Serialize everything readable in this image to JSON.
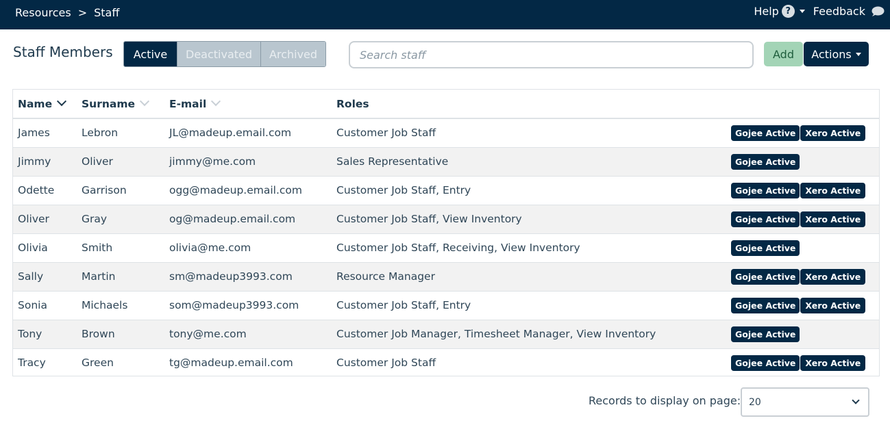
{
  "breadcrumb": {
    "root": "Resources",
    "separator": ">",
    "current": "Staff"
  },
  "topbar": {
    "help_label": "Help",
    "help_icon": "?",
    "feedback_label": "Feedback"
  },
  "page": {
    "title": "Staff Members"
  },
  "tabs": [
    {
      "label": "Active",
      "selected": true
    },
    {
      "label": "Deactivated",
      "selected": false
    },
    {
      "label": "Archived",
      "selected": false
    }
  ],
  "search": {
    "placeholder": "Search staff",
    "value": ""
  },
  "buttons": {
    "add": "Add",
    "actions": "Actions"
  },
  "table": {
    "columns": [
      {
        "label": "Name",
        "sorted": true
      },
      {
        "label": "Surname",
        "sorted": false
      },
      {
        "label": "E-mail",
        "sorted": false
      },
      {
        "label": "Roles"
      }
    ],
    "rows": [
      {
        "name": "James",
        "surname": "Lebron",
        "email": "JL@madeup.email.com",
        "roles": "Customer Job Staff",
        "gojee": "Gojee Active",
        "xero": "Xero Active"
      },
      {
        "name": "Jimmy",
        "surname": "Oliver",
        "email": "jimmy@me.com",
        "roles": "Sales Representative",
        "gojee": "Gojee Active",
        "xero": ""
      },
      {
        "name": "Odette",
        "surname": "Garrison",
        "email": "ogg@madeup.email.com",
        "roles": "Customer Job Staff, Entry",
        "gojee": "Gojee Active",
        "xero": "Xero Active"
      },
      {
        "name": "Oliver",
        "surname": "Gray",
        "email": "og@madeup.email.com",
        "roles": "Customer Job Staff, View Inventory",
        "gojee": "Gojee Active",
        "xero": "Xero Active"
      },
      {
        "name": "Olivia",
        "surname": "Smith",
        "email": "olivia@me.com",
        "roles": "Customer Job Staff, Receiving, View Inventory",
        "gojee": "Gojee Active",
        "xero": ""
      },
      {
        "name": "Sally",
        "surname": "Martin",
        "email": "sm@madeup3993.com",
        "roles": "Resource Manager",
        "gojee": "Gojee Active",
        "xero": "Xero Active"
      },
      {
        "name": "Sonia",
        "surname": "Michaels",
        "email": "som@madeup3993.com",
        "roles": "Customer Job Staff, Entry",
        "gojee": "Gojee Active",
        "xero": "Xero Active"
      },
      {
        "name": "Tony",
        "surname": "Brown",
        "email": "tony@me.com",
        "roles": "Customer Job Manager, Timesheet Manager, View Inventory",
        "gojee": "Gojee Active",
        "xero": ""
      },
      {
        "name": "Tracy",
        "surname": "Green",
        "email": "tg@madeup.email.com",
        "roles": "Customer Job Staff",
        "gojee": "Gojee Active",
        "xero": "Xero Active"
      }
    ]
  },
  "pagination": {
    "records_label": "Records to display on page:",
    "records_value": "20"
  },
  "colors": {
    "navy": "#032845",
    "add_green": "#a3d4b6",
    "tab_inactive": "#b9c6cf"
  },
  "icons": {
    "help": "question-circle-icon",
    "feedback": "speech-bubble-icon",
    "sort": "chevron-down-icon"
  }
}
